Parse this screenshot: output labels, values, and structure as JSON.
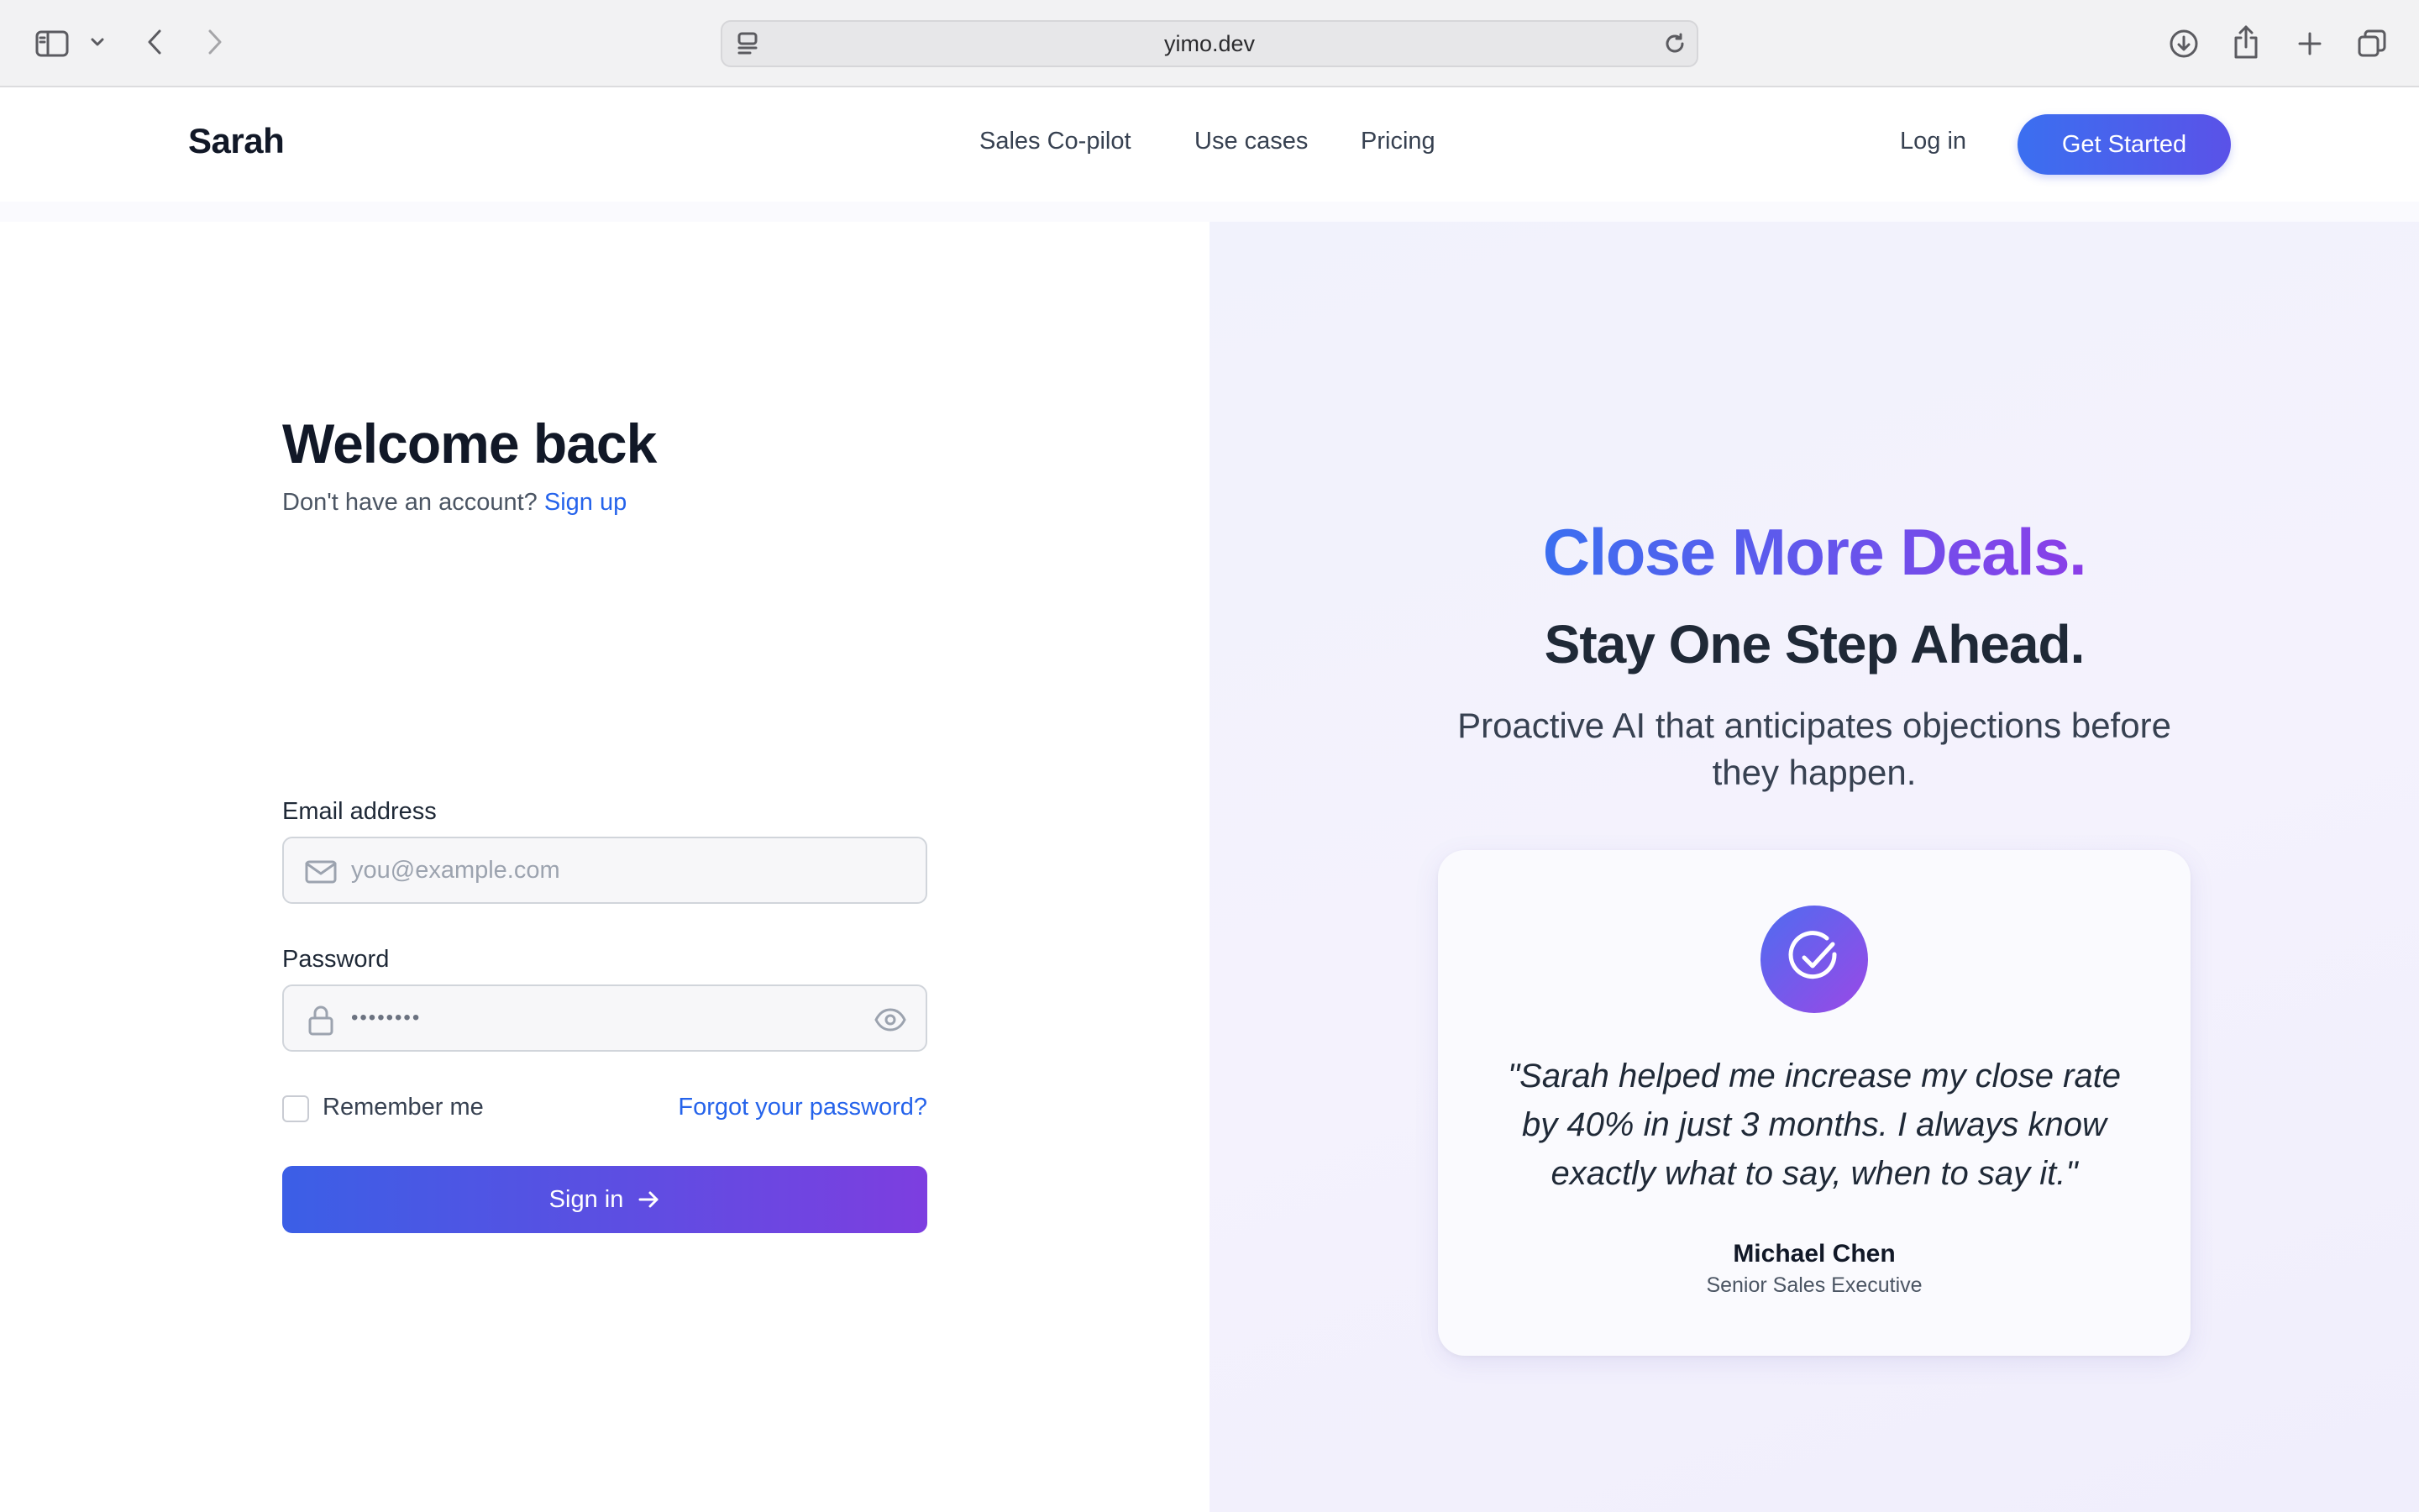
{
  "browser": {
    "url": "yimo.dev",
    "icons": [
      "sidebar-icon",
      "chevron-down-icon",
      "back-icon",
      "forward-icon",
      "page-icon",
      "reload-icon",
      "download-icon",
      "share-icon",
      "new-tab-icon",
      "tabs-icon"
    ]
  },
  "header": {
    "brand": "Sarah",
    "nav": [
      "Sales Co-pilot",
      "Use cases",
      "Pricing"
    ],
    "login": "Log in",
    "cta": "Get Started"
  },
  "login": {
    "title": "Welcome back",
    "no_account": "Don't have an account?",
    "signup_link": "Sign up",
    "email_label": "Email address",
    "email_placeholder": "you@example.com",
    "password_label": "Password",
    "password_value": "••••••••",
    "remember_label": "Remember me",
    "remember_checked": false,
    "forgot_link": "Forgot your password?",
    "submit": "Sign in"
  },
  "hero": {
    "headline": "Close More Deals.",
    "subheadline": "Stay One Step Ahead.",
    "description": "Proactive AI that anticipates objections before they happen.",
    "testimonial": {
      "quote": "\"Sarah helped me increase my close rate by 40% in just 3 months. I always know exactly what to say, when to say it.\"",
      "author": "Michael Chen",
      "role": "Senior Sales Executive"
    }
  },
  "colors": {
    "accent_blue": "#2563eb",
    "gradient_start": "#3b6ff0",
    "gradient_end": "#8b3ee8",
    "chrome_bg": "#f2f2f3"
  }
}
